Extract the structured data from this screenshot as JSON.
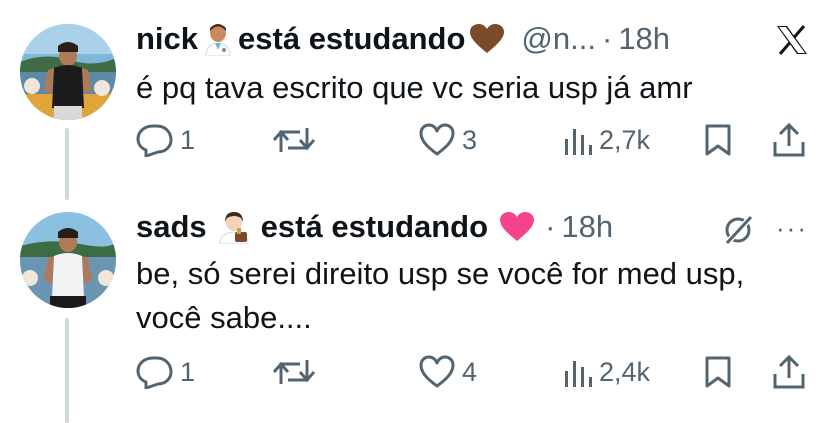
{
  "tweets": [
    {
      "name": "nick",
      "status_text": "está estudando",
      "handle": "@n...",
      "dot": "·",
      "time": "18h",
      "text": "é pq tava escrito que vc seria usp já amr",
      "replies": "1",
      "reposts": "",
      "likes": "3",
      "views": "2,7k",
      "corner_icon": "x-logo-icon"
    },
    {
      "name": "sads",
      "status_text": "está estudando",
      "dot": "·",
      "time": "18h",
      "text": "be, só serei direito usp se você for med usp, você sabe....",
      "replies": "1",
      "reposts": "",
      "likes": "4",
      "views": "2,4k",
      "corner_icon": "grok-icon",
      "more_label": "···"
    }
  ],
  "colors": {
    "text": "#0f1419",
    "secondary": "#536471",
    "thread_line": "#cfd9de",
    "heart_pink": "#f5428d",
    "brown_heart": "#7a4a2a"
  }
}
